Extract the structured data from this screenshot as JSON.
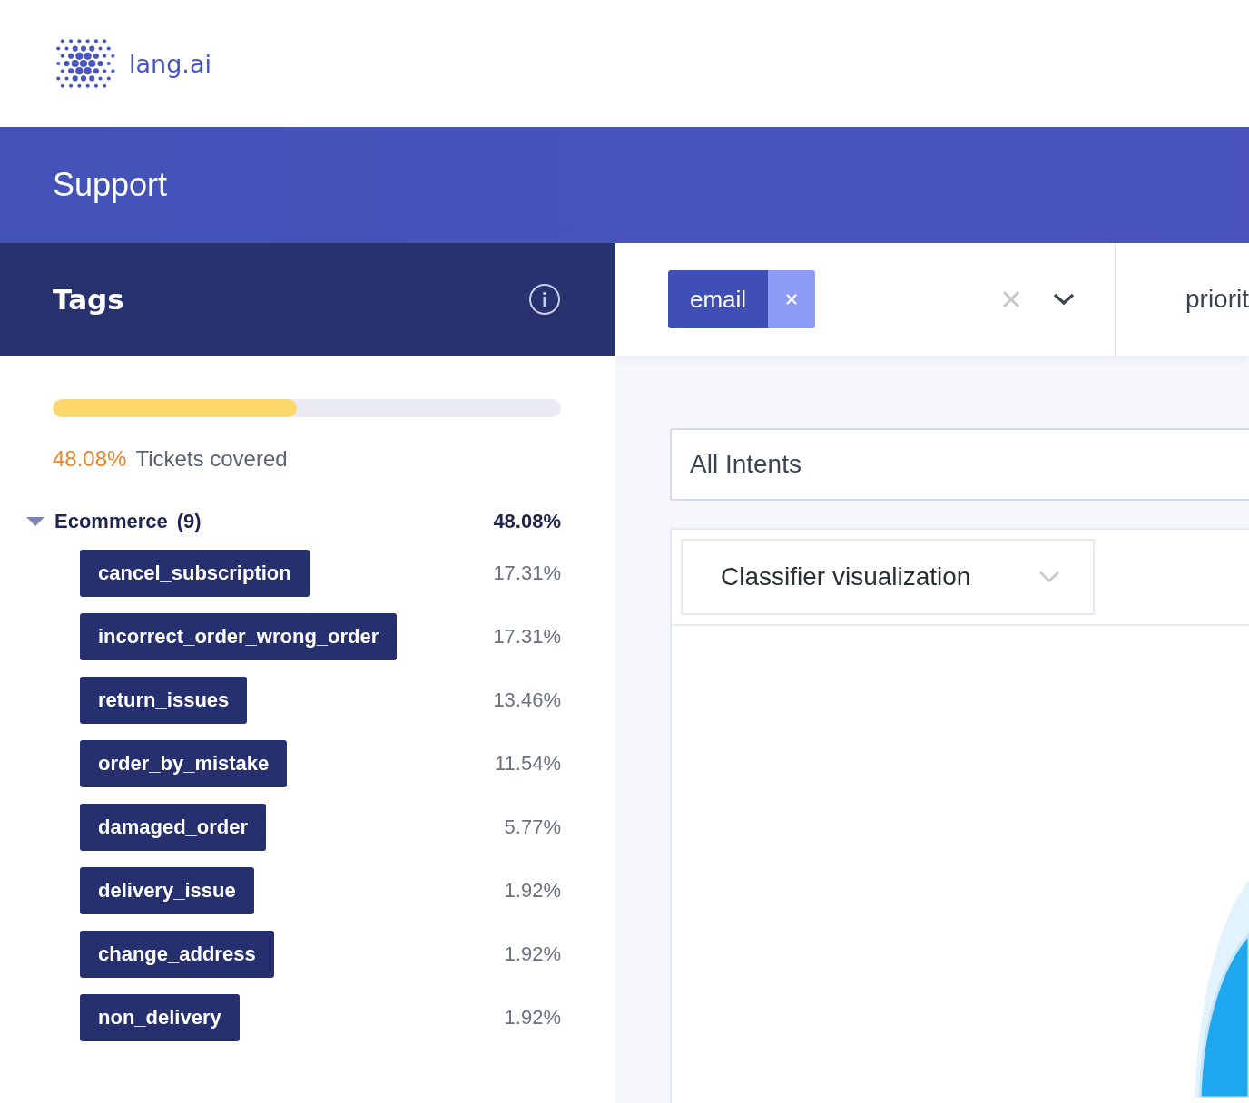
{
  "logo": {
    "text": "lang.ai"
  },
  "banner": {
    "title": "Support"
  },
  "sidebar": {
    "title": "Tags",
    "coverage": {
      "level": 0.48,
      "percent": "48.08%",
      "label": "Tickets covered"
    },
    "groups": [
      {
        "name": "Ecommerce",
        "count": "(9)",
        "percent": "48.08%",
        "expanded": true,
        "children": [
          {
            "name": "cancel_subscription",
            "percent": "17.31%"
          },
          {
            "name": "incorrect_order_wrong_order",
            "percent": "17.31%"
          },
          {
            "name": "return_issues",
            "percent": "13.46%"
          },
          {
            "name": "order_by_mistake",
            "percent": "11.54%"
          },
          {
            "name": "damaged_order",
            "percent": "5.77%"
          },
          {
            "name": "delivery_issue",
            "percent": "1.92%"
          },
          {
            "name": "change_address",
            "percent": "1.92%"
          },
          {
            "name": "non_delivery",
            "percent": "1.92%"
          }
        ]
      }
    ]
  },
  "filters": {
    "chips": [
      "email"
    ],
    "next_filter": "priorit"
  },
  "intents_field": {
    "value": "All Intents"
  },
  "view_select": {
    "value": "Classifier visualization"
  }
}
